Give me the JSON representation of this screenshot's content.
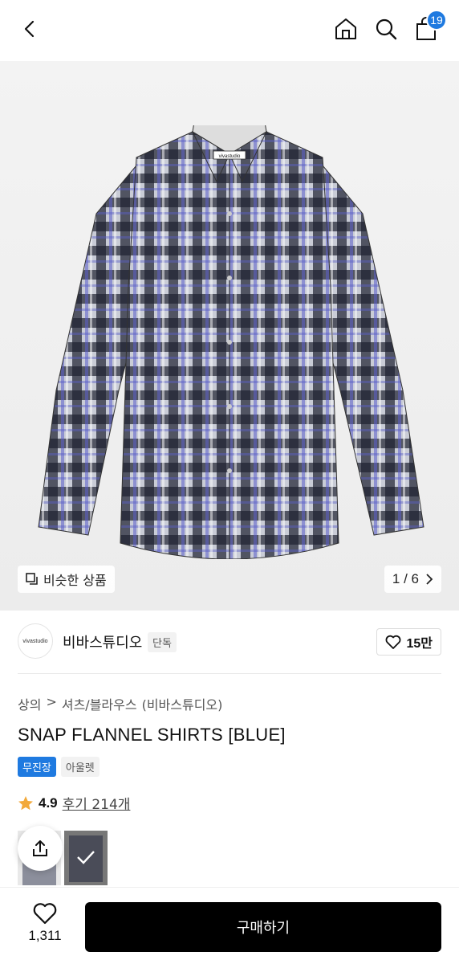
{
  "nav": {
    "back_icon": "chevron-left-icon",
    "home_icon": "home-icon",
    "search_icon": "search-icon",
    "cart_icon": "bag-icon",
    "cart_count": "19"
  },
  "gallery": {
    "similar_label": "비슷한 상품",
    "page_indicator": "1 / 6",
    "shirt_label": "vivastudio"
  },
  "brand": {
    "logo_text": "vivastudio",
    "name": "비바스튜디오",
    "exclusive_tag": "단독",
    "likes": "15만"
  },
  "product": {
    "breadcrumb": [
      "상의",
      ">",
      "셔츠/블라우스",
      "(비바스튜디오)"
    ],
    "title": "SNAP FLANNEL SHIRTS [BLUE]",
    "tag_primary": "무진장",
    "tag_secondary": "아울렛",
    "rating": "4.9",
    "reviews": "후기 214개"
  },
  "bottom": {
    "wish_count": "1,311",
    "buy_label": "구매하기"
  },
  "colors": {
    "accent": "#1f7ae0",
    "star": "#f2a93b",
    "buy_button": "#000000"
  }
}
